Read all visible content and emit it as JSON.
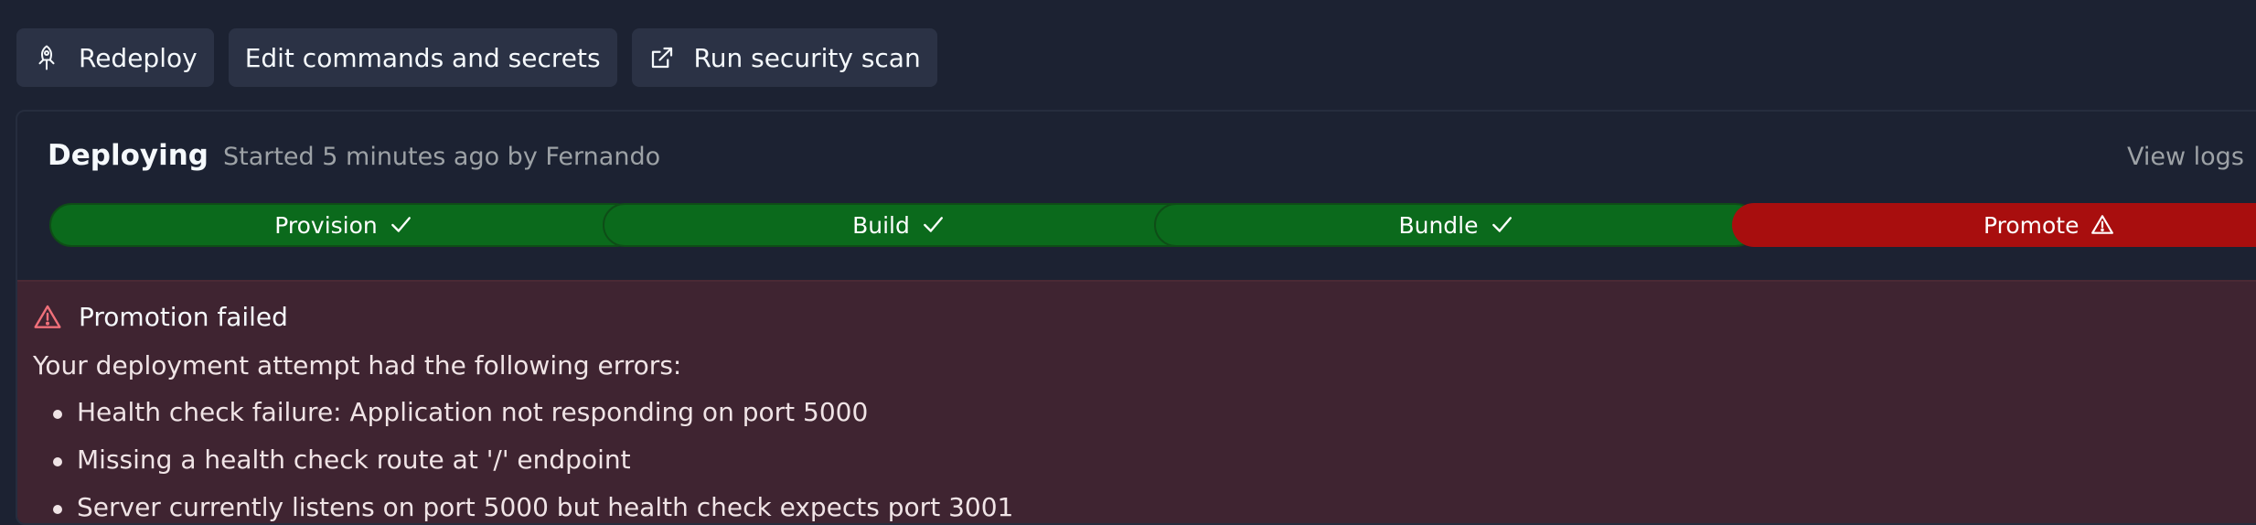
{
  "toolbar": {
    "redeploy_label": "Redeploy",
    "edit_label": "Edit commands and secrets",
    "scan_label": "Run security scan",
    "redeploy_icon": "redeploy-icon",
    "scan_icon": "external-link-icon"
  },
  "deployment": {
    "status": "Deploying",
    "started": "Started 5 minutes ago by Fernando",
    "view_logs": "View logs"
  },
  "steps": [
    {
      "label": "Provision",
      "state": "success",
      "icon": "check-icon"
    },
    {
      "label": "Build",
      "state": "success",
      "icon": "check-icon"
    },
    {
      "label": "Bundle",
      "state": "success",
      "icon": "check-icon"
    },
    {
      "label": "Promote",
      "state": "failed",
      "icon": "warning-icon"
    }
  ],
  "error": {
    "title": "Promotion failed",
    "intro": "Your deployment attempt had the following errors:",
    "items": [
      "Health check failure: Application not responding on port 5000",
      "Missing a health check route at '/' endpoint",
      "Server currently listens on port 5000 but health check expects port 3001"
    ]
  },
  "colors": {
    "background": "#1c2232",
    "button": "#2b3245",
    "success": "#0b6a1c",
    "failed": "#a80e0e",
    "error_bg": "#3f2431",
    "error_icon": "#f0707a"
  }
}
